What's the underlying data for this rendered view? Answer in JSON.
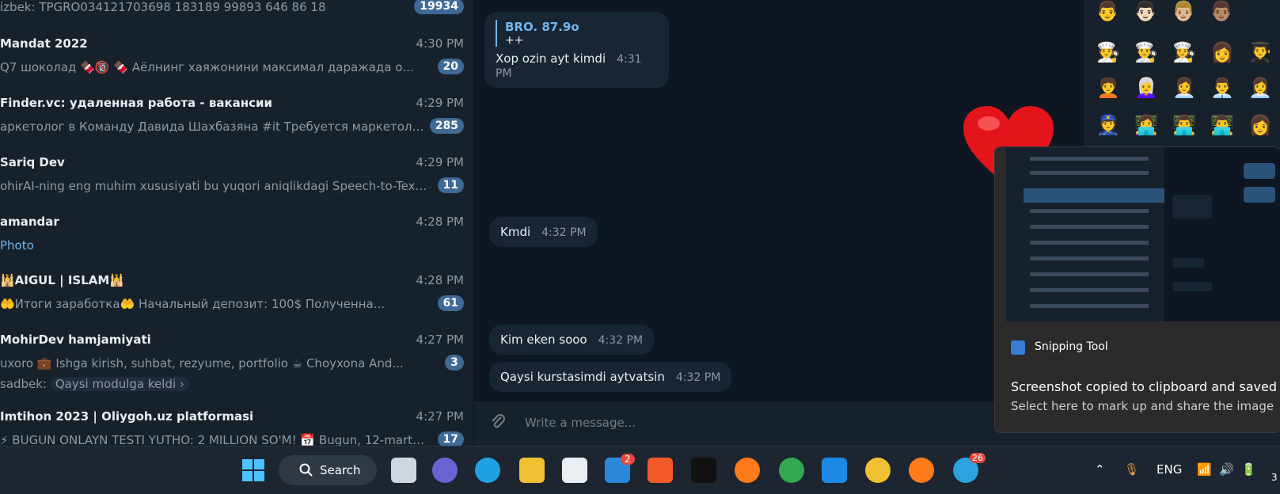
{
  "chats": [
    {
      "title": "",
      "time": "",
      "preview": "izbek: TPGRO034121703698 183189 99893 646 86 18",
      "badge": "19934"
    },
    {
      "title": "Mandat 2022",
      "time": "4:30 PM",
      "preview": "Q7 шоколад 🍫🔞  🍫 Аёлнинг хаяжонини максимал даражада о...",
      "badge": "20"
    },
    {
      "title": "Finder.vc: удаленная работа - вакансии",
      "time": "4:29 PM",
      "preview": "аркетолог в Команду Давида Шахбазяна #it  Требуется маркетолог ...",
      "badge": "285"
    },
    {
      "title": "Sariq Dev",
      "time": "4:29 PM",
      "preview": "ohirAI-ning eng muhim xususiyati bu yuqori aniqlikdagi Speech-to-Text ...",
      "badge": "11"
    },
    {
      "title": "amandar",
      "time": "4:28 PM",
      "preview": "Photo",
      "badge": ""
    },
    {
      "title": "🕌AIGUL | ISLAM🕌",
      "time": "4:28 PM",
      "preview": "🤲Итоги заработка🤲  Начальный депозит: 100$  Полученна...",
      "badge": "61"
    },
    {
      "title": "MohirDev hamjamiyati",
      "time": "4:27 PM",
      "preview": "uxoro   💼 Ishga kirish, suhbat, rezyume, portfolio   ☕ Choyxona   And...",
      "badge": "3",
      "sub_name": "sadbek:",
      "sub_text": "Qaysi modulga keldi ›"
    },
    {
      "title": "Imtihon 2023 | Oliygoh.uz platformasi",
      "time": "4:27 PM",
      "preview": "⚡ BUGUN ONLAYN TESTI YUTHO: 2 MILLION SO'M! 📅 Bugun, 12-mart k...",
      "badge": "17"
    }
  ],
  "messages": {
    "m1": {
      "reply_name": "BRO. 87.9o",
      "reply_text": "++",
      "text": "Xop ozin ayt kimdi",
      "time": "4:31 PM"
    },
    "m2": {
      "text": "Kmdi",
      "time": "4:32 PM"
    },
    "m3": {
      "text": "Kim eken sooo",
      "time": "4:32 PM"
    },
    "m4": {
      "text": "Qaysi kurstasimdi aytvatsin",
      "time": "4:32 PM"
    }
  },
  "composer": {
    "placeholder": "Write a message..."
  },
  "toast": {
    "app": "Snipping Tool",
    "title": "Screenshot copied to clipboard and saved",
    "body": "Select here to mark up and share the image"
  },
  "taskbar": {
    "search_label": "Search",
    "mail_badge": "2",
    "telegram_badge": "26",
    "lang": "ENG",
    "clock_partial": "3"
  },
  "emojis": [
    "👨",
    "👨🏻",
    "👨🏼",
    "👨🏽",
    "🧑‍🍳",
    "👨‍🍳",
    "👩‍🍳",
    "👩",
    "👨‍🎓",
    "🧑‍🦱",
    "👩‍🦳",
    "👩‍💼",
    "👨‍💼",
    "👩‍💼",
    "👮",
    "👩‍💻",
    "👨‍💻",
    "👨‍💻",
    "👩"
  ],
  "colors": {
    "sidebar": "#17212b",
    "chat_bg": "#0e1621",
    "bubble": "#182533",
    "accent": "#71b6ee",
    "badge": "#3e6a96",
    "toast": "#2b2b2b"
  }
}
